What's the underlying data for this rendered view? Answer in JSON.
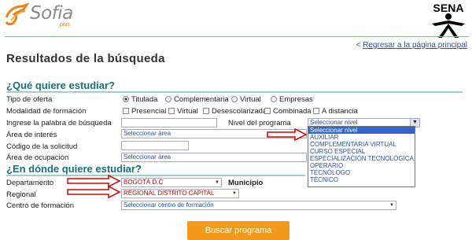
{
  "header": {
    "brand": "Sofia",
    "brand_sub": "plus",
    "sena": "SENA",
    "back_link": "Regresar a la página principal",
    "back_prefix": "<"
  },
  "page_title": "Resultados de la búsqueda",
  "section_what": {
    "title": "¿Qué quiere estudiar?",
    "tipo_oferta": {
      "label": "Tipo de oferta",
      "options": [
        "Titulada",
        "Complementaria",
        "Virtual",
        "Empresas"
      ],
      "selected": "Titulada"
    },
    "modalidad": {
      "label": "Modalidad de formación",
      "options": [
        "Presencial",
        "Virtual",
        "Desescolarizada",
        "Combinada",
        "A distancia"
      ]
    },
    "palabra": {
      "label": "Ingrese la palabra de búsqueda",
      "value": ""
    },
    "nivel": {
      "label": "Nivel del programa",
      "value": "Seleccionar nivel",
      "options": [
        "Seleccionar nivel",
        "AUXILIAR",
        "COMPLEMENTARIA VIRTUAL",
        "CURSO ESPECIAL",
        "ESPECIALIZACIÓN TECNOLÓGICA",
        "OPERARIO",
        "TECNÓLOGO",
        "TÉCNICO"
      ]
    },
    "area_interes": {
      "label": "Área de interés",
      "value": "Seleccionar área"
    },
    "codigo": {
      "label": "Código de la solicitud",
      "value": ""
    },
    "area_ocupacion": {
      "label": "Área de ocupación",
      "value": "Seleccionar área"
    }
  },
  "section_where": {
    "title": "¿En dónde quiere estudiar?",
    "departamento": {
      "label": "Departamento",
      "value": "BOGOTÁ D.C"
    },
    "municipio": {
      "label": "Municipio"
    },
    "regional": {
      "label": "Regional",
      "value": "REGIONAL DISTRITO CAPITAL"
    },
    "centro": {
      "label": "Centro de formación",
      "value": "Seleccionar centro de formación"
    }
  },
  "search_button": "Buscar programa",
  "colors": {
    "accent": "#f39a1c",
    "section": "#1a6e7a",
    "annotation_arrow": "#d40000",
    "link": "#2b4fa8"
  }
}
